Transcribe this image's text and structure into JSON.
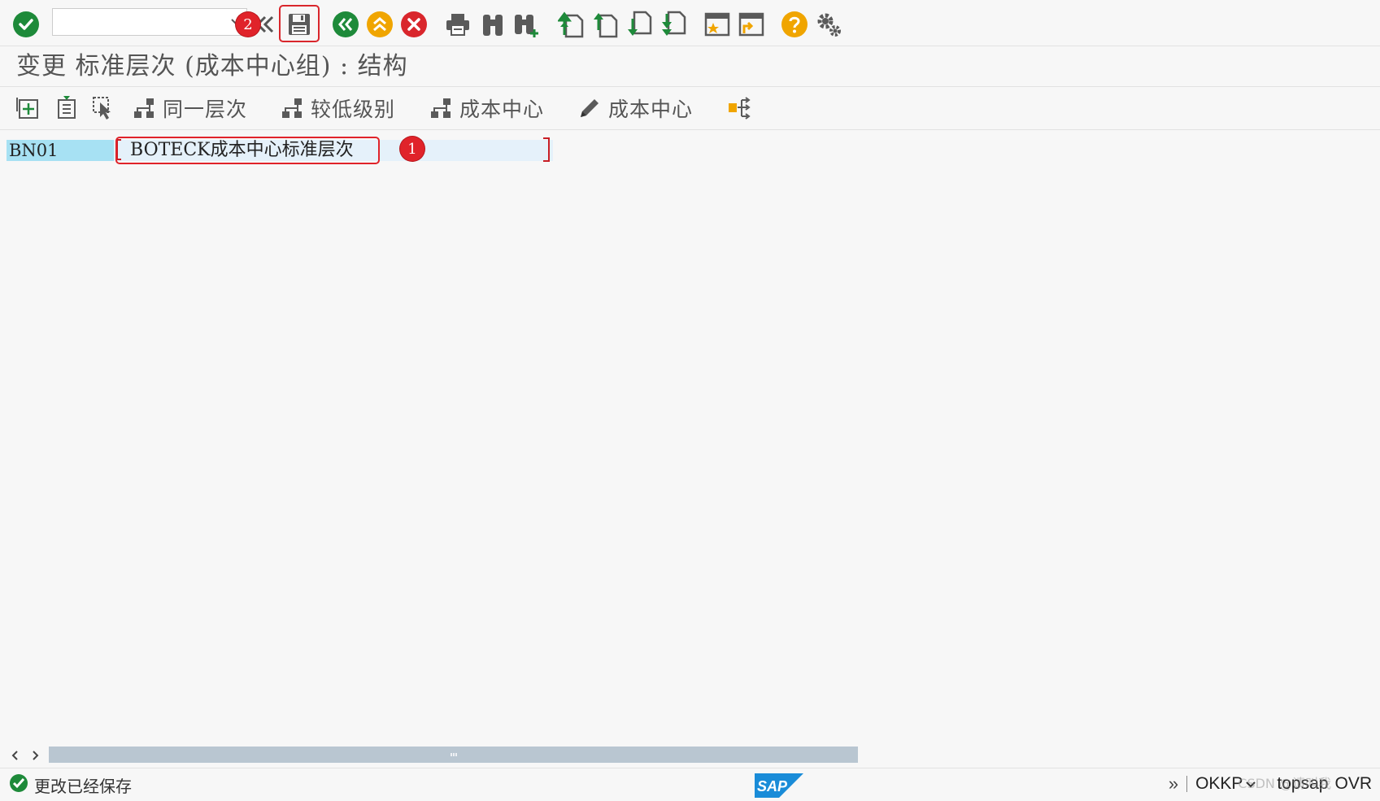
{
  "colors": {
    "green": "#1e8a3a",
    "orange": "#f0a500",
    "red": "#d9262c",
    "icon_gray": "#5a5a5a",
    "annotation_red": "#e0232a",
    "node_key_bg": "#a7e1f3",
    "node_text_bg": "#e5f1fa"
  },
  "system_toolbar": {
    "command_field_value": "",
    "icons": [
      "enter-check-icon",
      "save-icon",
      "back-icon",
      "exit-icon",
      "cancel-icon",
      "print-icon",
      "find-icon",
      "find-next-icon",
      "first-page-icon",
      "previous-page-icon",
      "next-page-icon",
      "last-page-icon",
      "create-session-icon",
      "shortcut-icon",
      "help-icon",
      "settings-icon"
    ]
  },
  "title": "变更 标准层次 (成本中心组) : 结构",
  "app_toolbar": {
    "same_level_label": "同一层次",
    "lower_level_label": "较低级别",
    "cost_center_label": "成本中心",
    "cost_center_edit_label": "成本中心"
  },
  "hierarchy": {
    "node_key": "BN01",
    "node_text": "BOTECK成本中心标准层次"
  },
  "annotations": {
    "badge_1": "1",
    "badge_2": "2"
  },
  "status_bar": {
    "message": "更改已经保存",
    "logo": "SAP",
    "more": "»",
    "transaction": "OKKP",
    "system": "topsap",
    "mode": "OVR",
    "watermark": "CSDN @请叫我"
  }
}
